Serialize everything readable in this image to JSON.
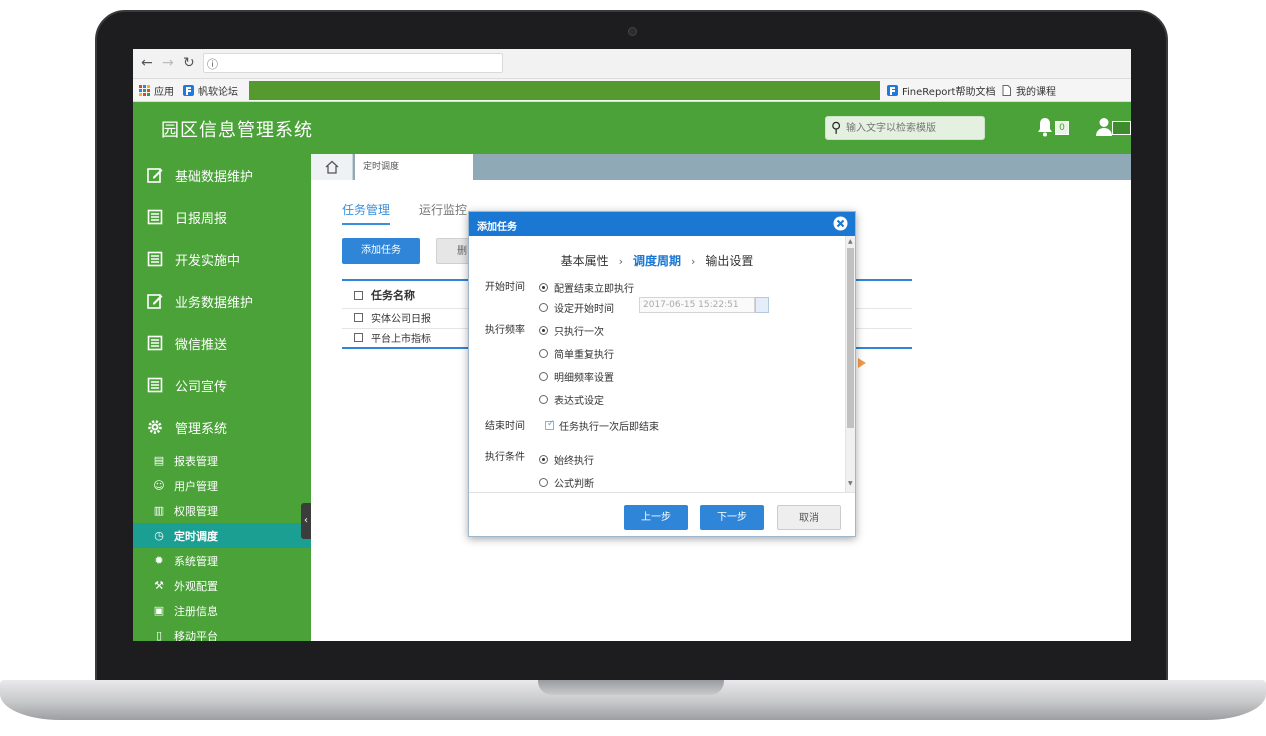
{
  "browser": {
    "bookmarks": {
      "apps": "应用",
      "fanruan": "帆软论坛",
      "finereport": "FineReport帮助文档",
      "courses": "我的课程"
    }
  },
  "header": {
    "app_title": "园区信息管理系统",
    "search_placeholder": "输入文字以检索模版",
    "notification_count": "0"
  },
  "sidebar": {
    "items": [
      {
        "label": "基础数据维护",
        "icon": "edit-icon"
      },
      {
        "label": "日报周报",
        "icon": "list-icon"
      },
      {
        "label": "开发实施中",
        "icon": "list-icon"
      },
      {
        "label": "业务数据维护",
        "icon": "edit-icon"
      },
      {
        "label": "微信推送",
        "icon": "list-icon"
      },
      {
        "label": "公司宣传",
        "icon": "list-icon"
      },
      {
        "label": "管理系统",
        "icon": "gear-icon"
      }
    ],
    "sub_items": [
      {
        "label": "报表管理",
        "icon": "report-icon"
      },
      {
        "label": "用户管理",
        "icon": "user-icon"
      },
      {
        "label": "权限管理",
        "icon": "lock-icon"
      },
      {
        "label": "定时调度",
        "icon": "clock-icon",
        "active": true
      },
      {
        "label": "系统管理",
        "icon": "settings-icon"
      },
      {
        "label": "外观配置",
        "icon": "brush-icon"
      },
      {
        "label": "注册信息",
        "icon": "register-icon"
      },
      {
        "label": "移动平台",
        "icon": "mobile-icon"
      }
    ]
  },
  "tabs": {
    "page_tab": "定时调度"
  },
  "content": {
    "tab_task_manage": "任务管理",
    "tab_run_monitor": "运行监控",
    "add_task_button": "添加任务",
    "delete_button": "删",
    "table": {
      "header": "任务名称",
      "rows": [
        "实体公司日报",
        "平台上市指标"
      ]
    }
  },
  "modal": {
    "title": "添加任务",
    "steps": [
      "基本属性",
      "调度周期",
      "输出设置"
    ],
    "current_step": "调度周期",
    "start_time": {
      "label": "开始时间",
      "options": [
        "配置结束立即执行",
        "设定开始时间"
      ],
      "selected": "配置结束立即执行",
      "datetime": "2017-06-15 15:22:51"
    },
    "frequency": {
      "label": "执行频率",
      "options": [
        "只执行一次",
        "简单重复执行",
        "明细频率设置",
        "表达式设定"
      ],
      "selected": "只执行一次"
    },
    "end_time": {
      "label": "结束时间",
      "checkbox": "任务执行一次后即结束"
    },
    "condition": {
      "label": "执行条件",
      "options": [
        "始终执行",
        "公式判断"
      ],
      "selected": "始终执行"
    },
    "buttons": {
      "prev": "上一步",
      "next": "下一步",
      "cancel": "取消"
    }
  },
  "colors": {
    "brand_green": "#4aa238",
    "accent_blue": "#1a77d2",
    "active_teal": "#1b9f93"
  }
}
